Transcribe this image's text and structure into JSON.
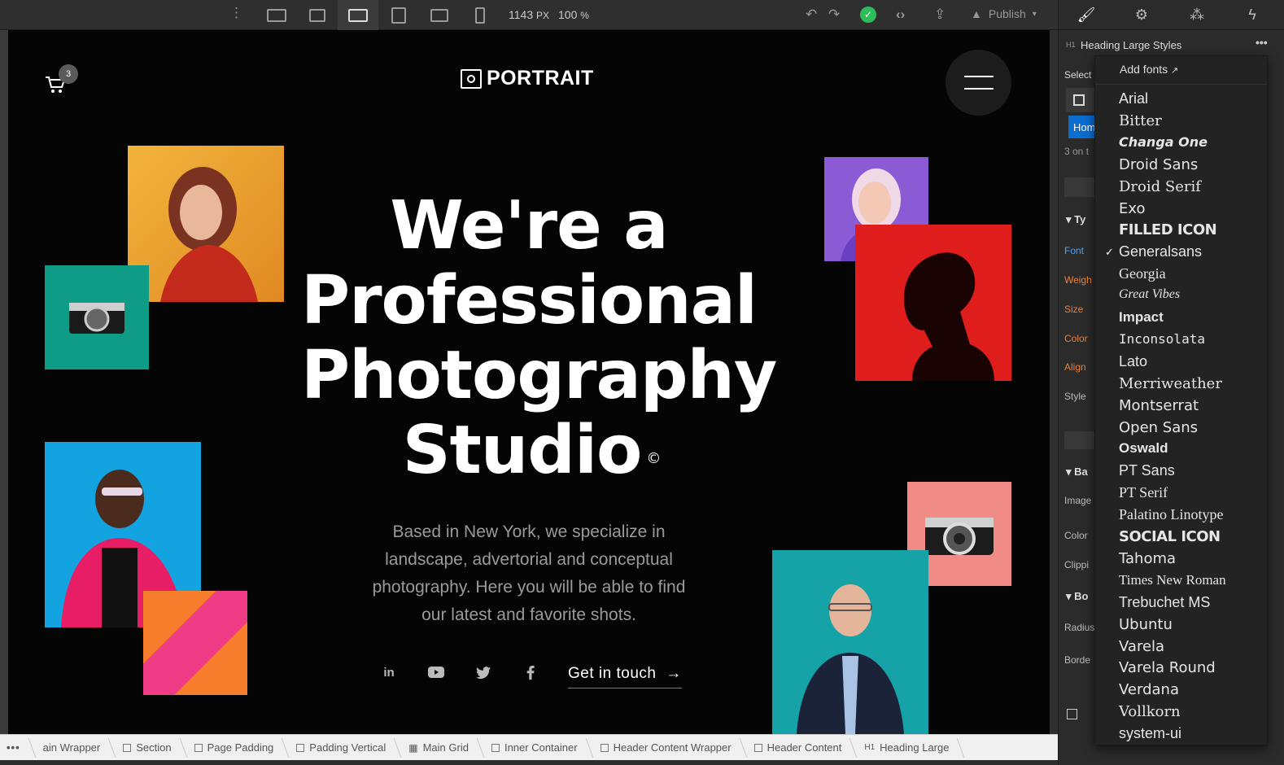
{
  "toolbar": {
    "width_px": "1143",
    "width_unit": "PX",
    "zoom": "100",
    "zoom_unit": "%",
    "publish_label": "Publish"
  },
  "site": {
    "logo_text": "PORTRAIT",
    "cart_count": "3",
    "title_line1": "We're a",
    "title_line2": "Professional",
    "title_line3": "Photography",
    "title_line4": "Studio",
    "copyright_mark": "©",
    "subtitle": "Based in New York, we specialize in landscape, advertorial and conceptual photography. Here you will be able to find our latest and favorite shots.",
    "social_linkedin": "in",
    "cta_label": "Get in touch",
    "cta_arrow": "→"
  },
  "breadcrumbs": [
    "ain Wrapper",
    "Section",
    "Page Padding",
    "Padding Vertical",
    "Main Grid",
    "Inner Container",
    "Header Content Wrapper",
    "Header Content",
    "Heading Large"
  ],
  "panel": {
    "style_tag": "H1",
    "style_name": "Heading Large Styles",
    "select_label": "Select",
    "selector_text": "Hom",
    "on_this_page": "3 on t",
    "typography": "Ty",
    "font": "Font",
    "weight": "Weigh",
    "size": "Size",
    "color": "Color",
    "align": "Align",
    "style": "Style",
    "backgrounds": "Ba",
    "image": "Image",
    "bg_color": "Color",
    "clipping": "Clippi",
    "borders": "Bo",
    "radius": "Radius",
    "border": "Borde"
  },
  "font_menu": {
    "add_fonts": "Add fonts",
    "selected": "Generalsans",
    "fonts": [
      "Arial",
      "Bitter",
      "Changa One",
      "Droid Sans",
      "Droid Serif",
      "Exo",
      "FILLED ICON",
      "Generalsans",
      "Georgia",
      "Great Vibes",
      "Impact",
      "Inconsolata",
      "Lato",
      "Merriweather",
      "Montserrat",
      "Open Sans",
      "Oswald",
      "PT Sans",
      "PT Serif",
      "Palatino Linotype",
      "SOCIAL ICON",
      "Tahoma",
      "Times New Roman",
      "Trebuchet MS",
      "Ubuntu",
      "Varela",
      "Varela Round",
      "Verdana",
      "Vollkorn",
      "system-ui"
    ]
  },
  "colors": {
    "canvas_bg": "#050505",
    "accent_blue": "#0a6ed1",
    "publish_green": "#2dbd5a",
    "panel_orange": "#e8803a"
  }
}
